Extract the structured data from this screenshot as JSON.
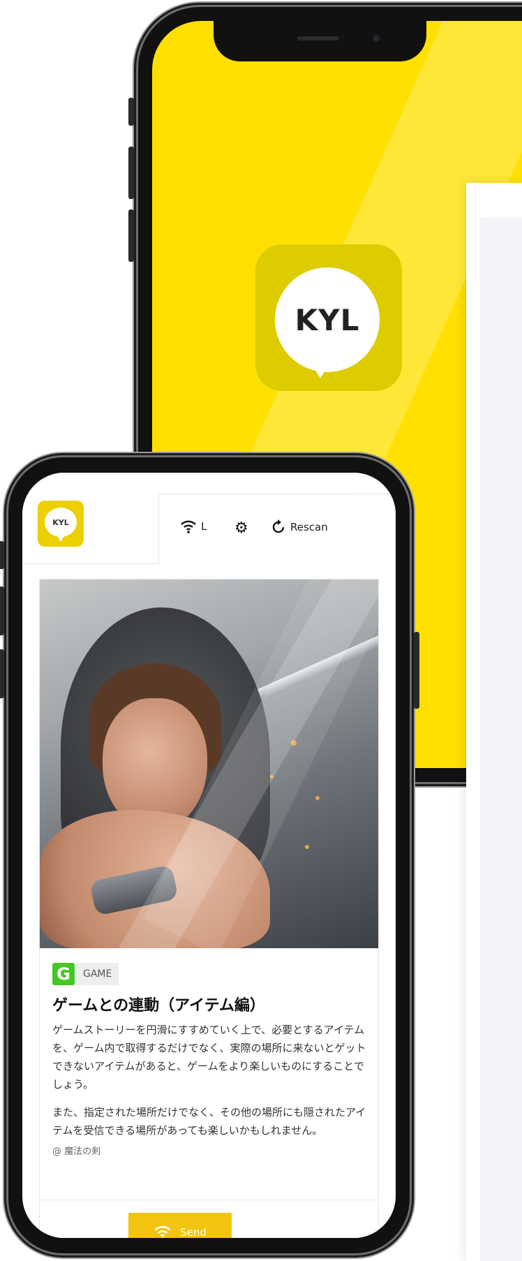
{
  "back_phone": {
    "app_logo_text": "KYL"
  },
  "front_phone": {
    "header": {
      "logo_text": "KYL",
      "wifi_icon": "wifi-icon",
      "wifi_label": "L",
      "settings_icon": "gear-icon",
      "rescan_icon": "refresh-icon",
      "rescan_label": "Rescan"
    },
    "article": {
      "category_letter": "G",
      "category_label": "GAME",
      "title": "ゲームとの連動（アイテム編）",
      "paragraph_1": "ゲームストーリーを円滑にすすめていく上で、必要とするアイテムを、ゲーム内で取得するだけでなく、実際の場所に来ないとゲットできないアイテムがあると、ゲームをより楽しいものにすることでしょう。",
      "paragraph_2": "また、指定された場所だけでなく、その他の場所にも隠されたアイテムを受信できる場所があっても楽しいかもしれません。",
      "author": "@ 魔法の剣"
    },
    "footer": {
      "send_label": "Send",
      "send_icon": "wifi-icon"
    }
  },
  "colors": {
    "brand_yellow": "#ffe000",
    "button_yellow": "#f2c40f",
    "game_green": "#44c825"
  }
}
